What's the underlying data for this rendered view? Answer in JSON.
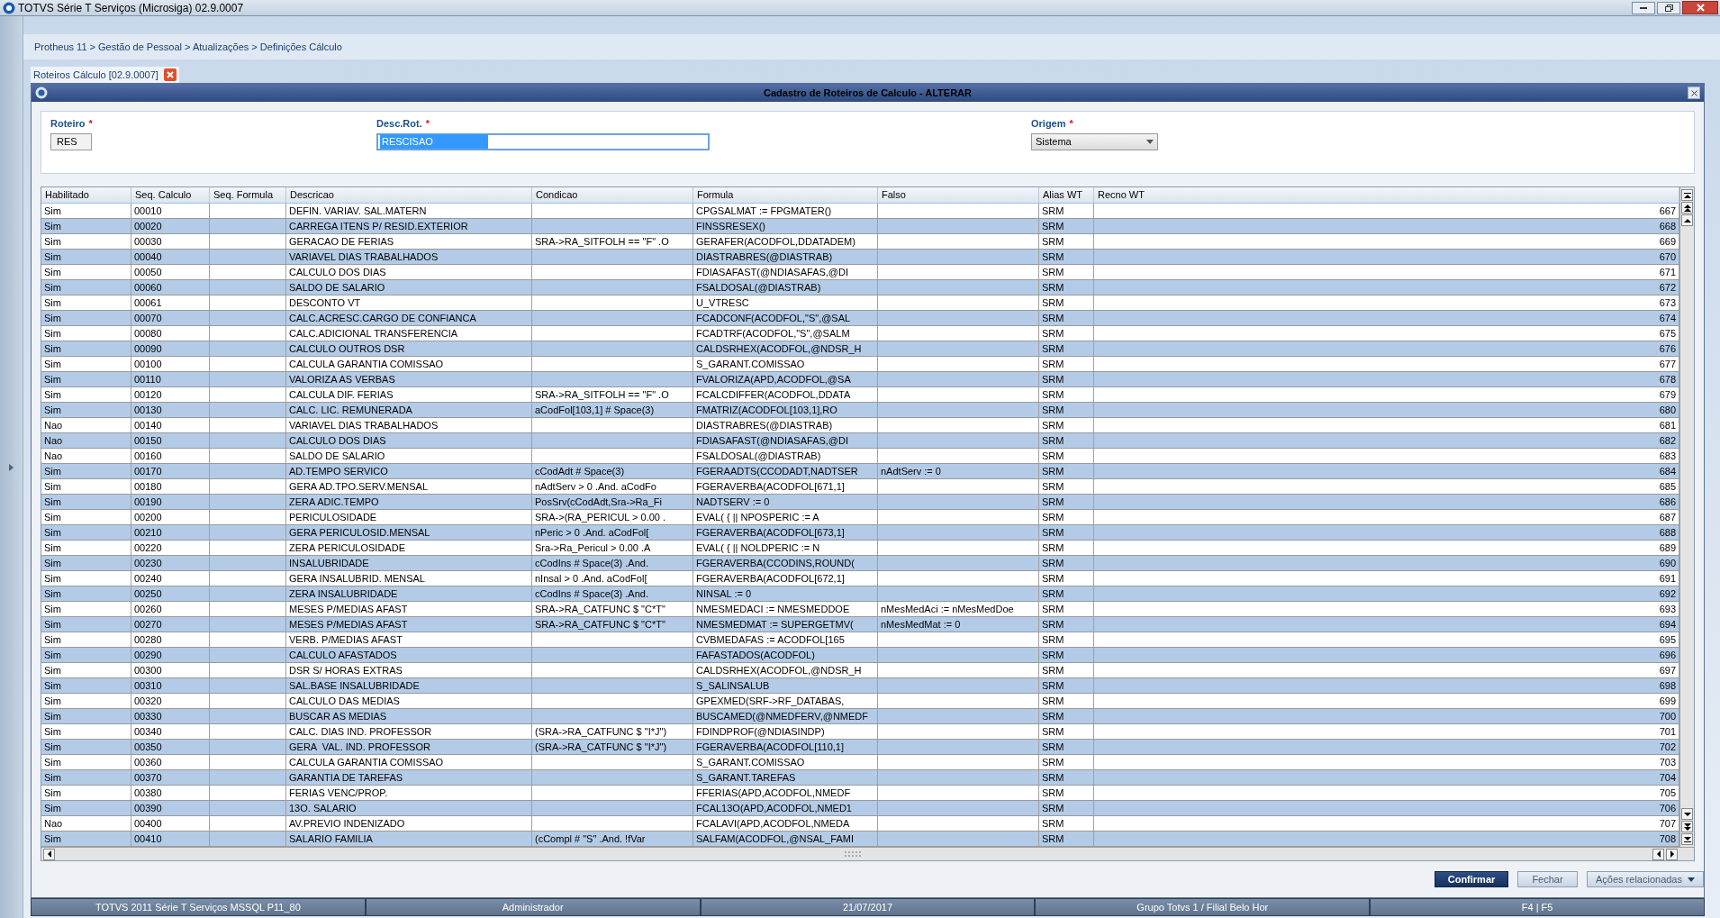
{
  "window": {
    "title": "TOTVS Série T Serviços (Microsiga) 02.9.0007"
  },
  "breadcrumb": "Protheus 11 > Gestão de Pessoal > Atualizações > Definições Cálculo",
  "tab": {
    "label": "Roteiros Cálculo [02.9.0007]",
    "selected": true
  },
  "dialog": {
    "title": "Cadastro de Roteiros de Calculo - ALTERAR"
  },
  "fields": [
    {
      "kind": "text",
      "label": "Roteiro",
      "required": "*",
      "value": "RES"
    },
    {
      "kind": "text",
      "label": "Desc.Rot.",
      "required": "*",
      "value": "RESCISAO",
      "selected": true
    },
    {
      "kind": "select",
      "label": "Origem",
      "required": "*",
      "value": "Sistema"
    }
  ],
  "table": {
    "columns": [
      "Habilitado",
      "Seq. Calculo",
      "Seq. Formula",
      "Descricao",
      "Condicao",
      "Formula",
      "Falso",
      "Alias WT",
      "Recno WT"
    ],
    "rows": [
      {
        "enabled": "Sim",
        "seq": "00010",
        "description": "DEFIN. VARIAV. SAL.MATERN",
        "formula": "CPGSALMAT := FPGMATER()",
        "alias": "SRM",
        "recno": "667"
      },
      {
        "enabled": "Sim",
        "seq": "00020",
        "description": "CARREGA ITENS P/ RESID.EXTERIOR",
        "formula": "FINSSRESEX()",
        "alias": "SRM",
        "recno": "668"
      },
      {
        "enabled": "Sim",
        "seq": "00030",
        "description": "GERACAO DE FERIAS",
        "condition": "SRA->RA_SITFOLH == \"F\" .O",
        "formula": "GERAFER(ACODFOL,DDATADEM)",
        "alias": "SRM",
        "recno": "669"
      },
      {
        "enabled": "Sim",
        "seq": "00040",
        "description": "VARIAVEL DIAS TRABALHADOS",
        "formula": "DIASTRABRES(@DIASTRAB)",
        "alias": "SRM",
        "recno": "670"
      },
      {
        "enabled": "Sim",
        "seq": "00050",
        "description": "CALCULO DOS DIAS",
        "formula": "FDIASAFAST(@NDIASAFAS,@DI",
        "alias": "SRM",
        "recno": "671"
      },
      {
        "enabled": "Sim",
        "seq": "00060",
        "description": "SALDO DE SALARIO",
        "formula": "FSALDOSAL(@DIASTRAB)",
        "alias": "SRM",
        "recno": "672"
      },
      {
        "enabled": "Sim",
        "seq": "00061",
        "description": "DESCONTO VT",
        "formula": "U_VTRESC",
        "alias": "SRM",
        "recno": "673"
      },
      {
        "enabled": "Sim",
        "seq": "00070",
        "description": "CALC.ACRESC.CARGO DE CONFIANCA",
        "formula": "FCADCONF(ACODFOL,\"S\",@SAL",
        "alias": "SRM",
        "recno": "674"
      },
      {
        "enabled": "Sim",
        "seq": "00080",
        "description": "CALC.ADICIONAL TRANSFERENCIA",
        "formula": "FCADTRF(ACODFOL,\"S\",@SALM",
        "alias": "SRM",
        "recno": "675"
      },
      {
        "enabled": "Sim",
        "seq": "00090",
        "description": "CALCULO OUTROS DSR",
        "formula": "CALDSRHEX(ACODFOL,@NDSR_H",
        "alias": "SRM",
        "recno": "676"
      },
      {
        "enabled": "Sim",
        "seq": "00100",
        "description": "CALCULA GARANTIA COMISSAO",
        "formula": "S_GARANT.COMISSAO",
        "alias": "SRM",
        "recno": "677"
      },
      {
        "enabled": "Sim",
        "seq": "00110",
        "description": "VALORIZA AS VERBAS",
        "formula": "FVALORIZA(APD,ACODFOL,@SA",
        "alias": "SRM",
        "recno": "678"
      },
      {
        "enabled": "Sim",
        "seq": "00120",
        "description": "CALCULA DIF. FERIAS",
        "condition": "SRA->RA_SITFOLH == \"F\" .O",
        "formula": "FCALCDIFFER(ACODFOL,DDATA",
        "alias": "SRM",
        "recno": "679"
      },
      {
        "enabled": "Sim",
        "seq": "00130",
        "description": "CALC. LIC. REMUNERADA",
        "condition": "aCodFol[103,1] # Space(3)",
        "formula": "FMATRIZ(ACODFOL[103,1],RO",
        "alias": "SRM",
        "recno": "680"
      },
      {
        "enabled": "Nao",
        "seq": "00140",
        "description": "VARIAVEL DIAS TRABALHADOS",
        "formula": "DIASTRABRES(@DIASTRAB)",
        "alias": "SRM",
        "recno": "681"
      },
      {
        "enabled": "Nao",
        "seq": "00150",
        "description": "CALCULO DOS DIAS",
        "formula": "FDIASAFAST(@NDIASAFAS,@DI",
        "alias": "SRM",
        "recno": "682"
      },
      {
        "enabled": "Nao",
        "seq": "00160",
        "description": "SALDO DE SALARIO",
        "formula": "FSALDOSAL(@DIASTRAB)",
        "alias": "SRM",
        "recno": "683"
      },
      {
        "enabled": "Sim",
        "seq": "00170",
        "description": "AD.TEMPO SERVICO",
        "condition": "cCodAdt # Space(3)",
        "formula": "FGERAADTS(CCODADT,NADTSER",
        "false_value": "nAdtServ := 0",
        "alias": "SRM",
        "recno": "684"
      },
      {
        "enabled": "Sim",
        "seq": "00180",
        "description": "GERA AD.TPO.SERV.MENSAL",
        "condition": "nAdtServ > 0 .And. aCodFo",
        "formula": "FGERAVERBA(ACODFOL[671,1]",
        "alias": "SRM",
        "recno": "685"
      },
      {
        "enabled": "Sim",
        "seq": "00190",
        "description": "ZERA ADIC.TEMPO",
        "condition": "PosSrv(cCodAdt,Sra->Ra_Fi",
        "formula": "NADTSERV := 0",
        "alias": "SRM",
        "recno": "686"
      },
      {
        "enabled": "Sim",
        "seq": "00200",
        "description": "PERICULOSIDADE",
        "condition": "SRA->(RA_PERICUL > 0.00 .",
        "formula": "EVAL( { || NPOSPERIC := A",
        "alias": "SRM",
        "recno": "687"
      },
      {
        "enabled": "Sim",
        "seq": "00210",
        "description": "GERA PERICULOSID.MENSAL",
        "condition": "nPeric > 0 .And. aCodFol[",
        "formula": "FGERAVERBA(ACODFOL[673,1]",
        "alias": "SRM",
        "recno": "688"
      },
      {
        "enabled": "Sim",
        "seq": "00220",
        "description": "ZERA PERICULOSIDADE",
        "condition": "Sra->Ra_Pericul > 0.00 .A",
        "formula": "EVAL( { || NOLDPERIC := N",
        "alias": "SRM",
        "recno": "689"
      },
      {
        "enabled": "Sim",
        "seq": "00230",
        "description": "INSALUBRIDADE",
        "condition": "cCodIns # Space(3) .And.",
        "formula": "FGERAVERBA(CCODINS,ROUND(",
        "alias": "SRM",
        "recno": "690"
      },
      {
        "enabled": "Sim",
        "seq": "00240",
        "description": "GERA INSALUBRID. MENSAL",
        "condition": "nInsal > 0 .And. aCodFol[",
        "formula": "FGERAVERBA(ACODFOL[672,1]",
        "alias": "SRM",
        "recno": "691"
      },
      {
        "enabled": "Sim",
        "seq": "00250",
        "description": "ZERA INSALUBRIDADE",
        "condition": "cCodIns # Space(3) .And.",
        "formula": "NINSAL := 0",
        "alias": "SRM",
        "recno": "692"
      },
      {
        "enabled": "Sim",
        "seq": "00260",
        "description": "MESES P/MEDIAS AFAST",
        "condition": "SRA->RA_CATFUNC $ \"C*T\"",
        "formula": "NMESMEDACI := NMESMEDDOE",
        "false_value": "nMesMedAci := nMesMedDoe",
        "alias": "SRM",
        "recno": "693"
      },
      {
        "enabled": "Sim",
        "seq": "00270",
        "description": "MESES P/MEDIAS AFAST",
        "condition": "SRA->RA_CATFUNC $ \"C*T\"",
        "formula": "NMESMEDMAT := SUPERGETMV(",
        "false_value": "nMesMedMat := 0",
        "alias": "SRM",
        "recno": "694"
      },
      {
        "enabled": "Sim",
        "seq": "00280",
        "description": "VERB. P/MEDIAS AFAST",
        "formula": "CVBMEDAFAS := ACODFOL[165",
        "alias": "SRM",
        "recno": "695"
      },
      {
        "enabled": "Sim",
        "seq": "00290",
        "description": "CALCULO AFASTADOS",
        "formula": "FAFASTADOS(ACODFOL)",
        "alias": "SRM",
        "recno": "696"
      },
      {
        "enabled": "Sim",
        "seq": "00300",
        "description": "DSR S/ HORAS EXTRAS",
        "formula": "CALDSRHEX(ACODFOL,@NDSR_H",
        "alias": "SRM",
        "recno": "697"
      },
      {
        "enabled": "Sim",
        "seq": "00310",
        "description": "SAL.BASE INSALUBRIDADE",
        "formula": "S_SALINSALUB",
        "alias": "SRM",
        "recno": "698"
      },
      {
        "enabled": "Sim",
        "seq": "00320",
        "description": "CALCULO DAS MEDIAS",
        "formula": "GPEXMED(SRF->RF_DATABAS,",
        "alias": "SRM",
        "recno": "699"
      },
      {
        "enabled": "Sim",
        "seq": "00330",
        "description": "BUSCAR AS MEDIAS",
        "formula": "BUSCAMED(@NMEDFERV,@NMEDF",
        "alias": "SRM",
        "recno": "700"
      },
      {
        "enabled": "Sim",
        "seq": "00340",
        "description": "CALC. DIAS IND. PROFESSOR",
        "condition": "(SRA->RA_CATFUNC $ \"I*J\")",
        "formula": "FDINDPROF(@NDIASINDP)",
        "alias": "SRM",
        "recno": "701"
      },
      {
        "enabled": "Sim",
        "seq": "00350",
        "description": "GERA  VAL. IND. PROFESSOR",
        "condition": "(SRA->RA_CATFUNC $ \"I*J\")",
        "formula": "FGERAVERBA(ACODFOL[110,1]",
        "alias": "SRM",
        "recno": "702"
      },
      {
        "enabled": "Sim",
        "seq": "00360",
        "description": "CALCULA GARANTIA COMISSAO",
        "formula": "S_GARANT.COMISSAO",
        "alias": "SRM",
        "recno": "703"
      },
      {
        "enabled": "Sim",
        "seq": "00370",
        "description": "GARANTIA DE TAREFAS",
        "formula": "S_GARANT.TAREFAS",
        "alias": "SRM",
        "recno": "704"
      },
      {
        "enabled": "Sim",
        "seq": "00380",
        "description": "FERIAS VENC/PROP.",
        "formula": "FFERIAS(APD,ACODFOL,NMEDF",
        "alias": "SRM",
        "recno": "705"
      },
      {
        "enabled": "Sim",
        "seq": "00390",
        "description": "13O. SALARIO",
        "formula": "FCAL13O(APD,ACODFOL,NMED1",
        "alias": "SRM",
        "recno": "706"
      },
      {
        "enabled": "Nao",
        "seq": "00400",
        "description": "AV.PREVIO INDENIZADO",
        "formula": "FCALAVI(APD,ACODFOL,NMEDA",
        "alias": "SRM",
        "recno": "707"
      },
      {
        "enabled": "Sim",
        "seq": "00410",
        "description": "SALARIO FAMILIA",
        "condition": "(cCompl # \"S\" .And. !fVar",
        "formula": "SALFAM(ACODFOL,@NSAL_FAMI",
        "alias": "SRM",
        "recno": "708"
      }
    ]
  },
  "buttons": [
    {
      "kind": "primary",
      "label": "Confirmar"
    },
    {
      "kind": "plain",
      "label": "Fechar"
    },
    {
      "kind": "menu",
      "label": "Ações relacionadas"
    }
  ],
  "status_bar": [
    "TOTVS 2011 Série T Serviços MSSQL P11_80",
    "Administrador",
    "21/07/2017",
    "Grupo Totvs 1 / Filial Belo Hor",
    "F4 | F5"
  ]
}
